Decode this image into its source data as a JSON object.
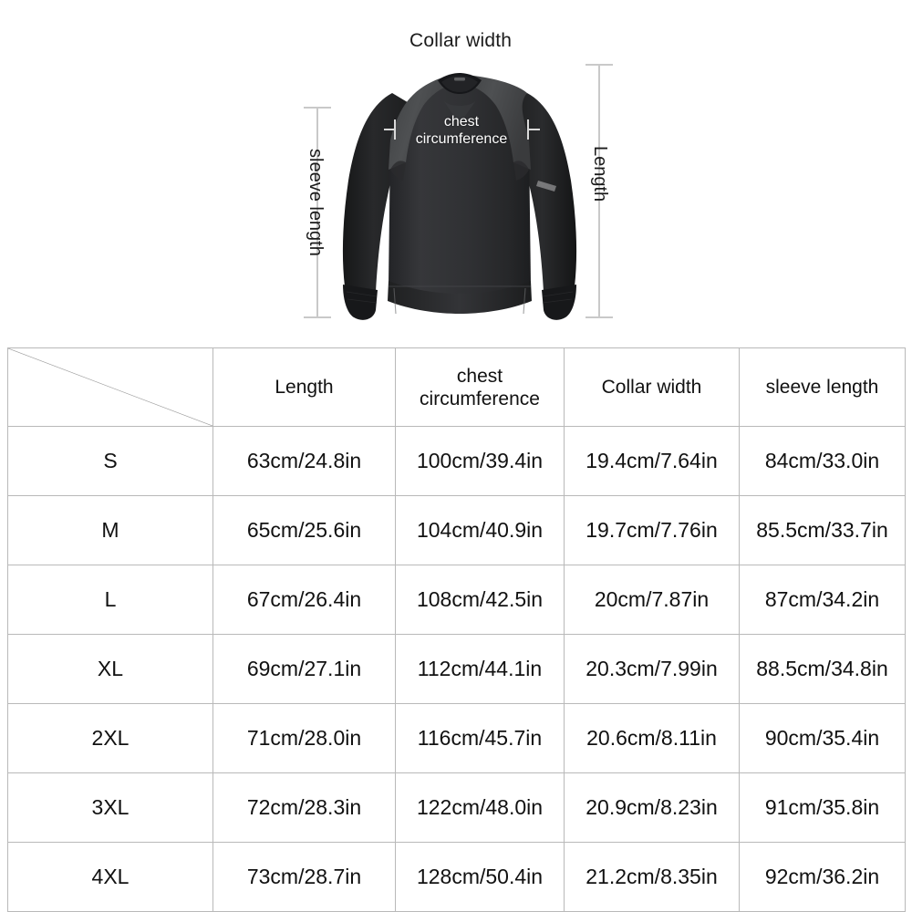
{
  "illustration": {
    "collar_width_label": "Collar width",
    "sleeve_length_label": "sleeve length",
    "length_label": "Length",
    "chest_label_line1": "chest",
    "chest_label_line2": "circumference",
    "garment_colors": {
      "body": "#2f3032",
      "shoulder_panel": "#4a4b4d",
      "sleeve_dark": "#232425",
      "cuff": "#2a2b2d",
      "hem": "#303133",
      "collar": "#1d1e20"
    },
    "guide_line_color": "#c9c9c9"
  },
  "table": {
    "headers": [
      "",
      "Length",
      "chest circumference",
      "Collar width",
      "sleeve length"
    ],
    "header_chest_line1": "chest",
    "header_chest_line2": "circumference",
    "rows": [
      {
        "size": "S",
        "length": "63cm/24.8in",
        "chest": "100cm/39.4in",
        "collar": "19.4cm/7.64in",
        "sleeve": "84cm/33.0in"
      },
      {
        "size": "M",
        "length": "65cm/25.6in",
        "chest": "104cm/40.9in",
        "collar": "19.7cm/7.76in",
        "sleeve": "85.5cm/33.7in"
      },
      {
        "size": "L",
        "length": "67cm/26.4in",
        "chest": "108cm/42.5in",
        "collar": "20cm/7.87in",
        "sleeve": "87cm/34.2in"
      },
      {
        "size": "XL",
        "length": "69cm/27.1in",
        "chest": "112cm/44.1in",
        "collar": "20.3cm/7.99in",
        "sleeve": "88.5cm/34.8in"
      },
      {
        "size": "2XL",
        "length": "71cm/28.0in",
        "chest": "116cm/45.7in",
        "collar": "20.6cm/8.11in",
        "sleeve": "90cm/35.4in"
      },
      {
        "size": "3XL",
        "length": "72cm/28.3in",
        "chest": "122cm/48.0in",
        "collar": "20.9cm/8.23in",
        "sleeve": "91cm/35.8in"
      },
      {
        "size": "4XL",
        "length": "73cm/28.7in",
        "chest": "128cm/50.4in",
        "collar": "21.2cm/8.35in",
        "sleeve": "92cm/36.2in"
      }
    ],
    "border_color": "#b9b9b9"
  }
}
